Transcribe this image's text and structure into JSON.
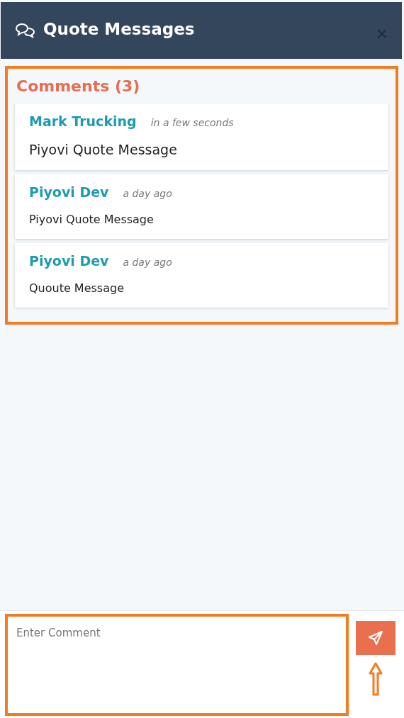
{
  "window": {
    "title": "Quote Messages",
    "close": "×"
  },
  "comments": {
    "heading": "Comments (3)",
    "items": [
      {
        "author": "Mark Trucking",
        "time": "in a few seconds",
        "text": "Piyovi Quote Message"
      },
      {
        "author": "Piyovi Dev",
        "time": "a day ago",
        "text": "Piyovi Quote Message"
      },
      {
        "author": "Piyovi Dev",
        "time": "a day ago",
        "text": "Quoute Message"
      }
    ]
  },
  "composer": {
    "placeholder": "Enter Comment"
  }
}
